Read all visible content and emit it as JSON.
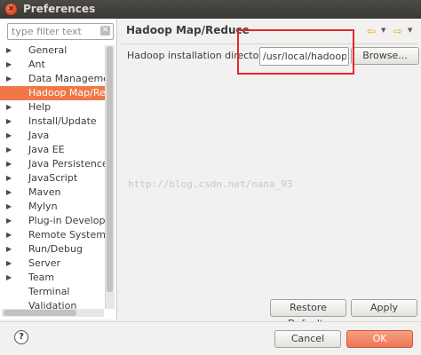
{
  "window": {
    "title": "Preferences",
    "close_glyph": "×"
  },
  "sidebar": {
    "filter_placeholder": "type filter text",
    "items": [
      {
        "label": "General",
        "expander": "▶"
      },
      {
        "label": "Ant",
        "expander": "▶"
      },
      {
        "label": "Data Management",
        "expander": "▶"
      },
      {
        "label": "Hadoop Map/Reduce",
        "expander": "",
        "selected": true
      },
      {
        "label": "Help",
        "expander": "▶"
      },
      {
        "label": "Install/Update",
        "expander": "▶"
      },
      {
        "label": "Java",
        "expander": "▶"
      },
      {
        "label": "Java EE",
        "expander": "▶"
      },
      {
        "label": "Java Persistence",
        "expander": "▶"
      },
      {
        "label": "JavaScript",
        "expander": "▶"
      },
      {
        "label": "Maven",
        "expander": "▶"
      },
      {
        "label": "Mylyn",
        "expander": "▶"
      },
      {
        "label": "Plug-in Development",
        "expander": "▶"
      },
      {
        "label": "Remote Systems",
        "expander": "▶"
      },
      {
        "label": "Run/Debug",
        "expander": "▶"
      },
      {
        "label": "Server",
        "expander": "▶"
      },
      {
        "label": "Team",
        "expander": "▶"
      },
      {
        "label": "Terminal",
        "expander": ""
      },
      {
        "label": "Validation",
        "expander": ""
      }
    ]
  },
  "page": {
    "title": "Hadoop Map/Reduce",
    "install_dir_label": "Hadoop installation directory:",
    "install_dir_value": "/usr/local/hadoop",
    "browse_label": "Browse...",
    "restore_defaults_label": "Restore Defaults",
    "apply_label": "Apply",
    "watermark": "http://blog.csdn.net/nana_93",
    "nav_back": "⇦",
    "nav_forward": "⇨",
    "nav_dropdown": "▼"
  },
  "footer": {
    "help_glyph": "?",
    "cancel_label": "Cancel",
    "ok_label": "OK"
  }
}
